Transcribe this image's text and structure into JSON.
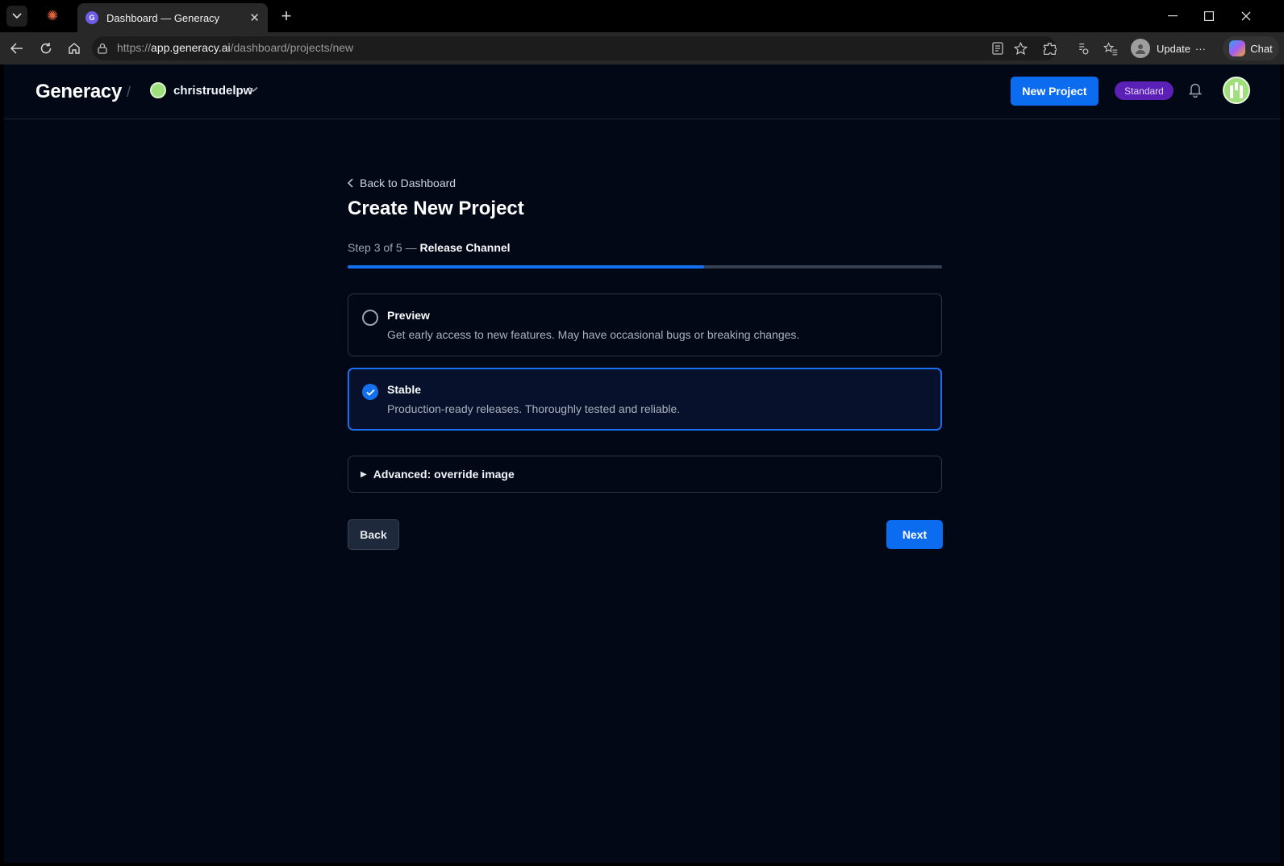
{
  "browser": {
    "tab_title": "Dashboard — Generacy",
    "tab_favicon_letter": "G",
    "url_scheme": "https://",
    "url_host": "app.generacy.ai",
    "url_path": "/dashboard/projects/new",
    "update_label": "Update",
    "chat_label": "Chat"
  },
  "header": {
    "logo": "Generacy",
    "separator": "/",
    "org_name": "christrudelpw",
    "new_project_label": "New Project",
    "plan_badge": "Standard"
  },
  "wizard": {
    "back_link": "Back to Dashboard",
    "title": "Create New Project",
    "step_prefix": "Step 3 of 5 —",
    "step_name": "Release Channel",
    "progress_fraction": 0.6,
    "options": [
      {
        "title": "Preview",
        "description": "Get early access to new features. May have occasional bugs or breaking changes.",
        "selected": false
      },
      {
        "title": "Stable",
        "description": "Production-ready releases. Thoroughly tested and reliable.",
        "selected": true
      }
    ],
    "advanced_label": "Advanced: override image",
    "back_button": "Back",
    "next_button": "Next"
  },
  "colors": {
    "accent": "#0b6cf0",
    "background": "#030817",
    "badge": "#5b21b6"
  }
}
